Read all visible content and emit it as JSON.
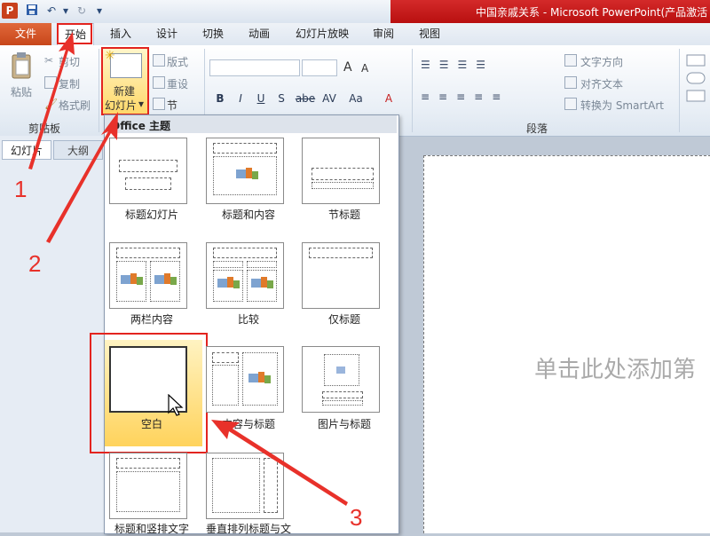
{
  "window": {
    "title": "中国亲戚关系 - Microsoft PowerPoint(产品激活",
    "app_icon": "P"
  },
  "tabs": {
    "file": "文件",
    "home": "开始",
    "insert": "插入",
    "design": "设计",
    "transitions": "切换",
    "animations": "动画",
    "slideshow": "幻灯片放映",
    "review": "审阅",
    "view": "视图"
  },
  "ribbon": {
    "clipboard": {
      "paste": "粘贴",
      "cut": "剪切",
      "copy": "复制",
      "format_painter": "格式刷",
      "label": "剪贴板"
    },
    "slides": {
      "new_slide_line1": "新建",
      "new_slide_line2": "幻灯片",
      "layout": "版式",
      "reset": "重设",
      "section": "节"
    },
    "font": {
      "grow": "A",
      "shrink": "A",
      "bold": "B",
      "italic": "I",
      "underline": "U",
      "shadow": "S",
      "strike": "abe",
      "spacing": "AV",
      "case": "Aa",
      "color": "A"
    },
    "paragraph": {
      "text_direction": "文字方向",
      "align_text": "对齐文本",
      "convert_smartart": "转换为 SmartArt",
      "label": "段落"
    }
  },
  "pane": {
    "tab_slides": "幻灯片",
    "tab_outline": "大纲"
  },
  "slide": {
    "placeholder": "单击此处添加第"
  },
  "gallery": {
    "title": "Office 主题",
    "layouts": [
      "标题幻灯片",
      "标题和内容",
      "节标题",
      "两栏内容",
      "比较",
      "仅标题",
      "空白",
      "内容与标题",
      "图片与标题",
      "标题和竖排文字",
      "垂直排列标题与文"
    ]
  },
  "annotations": {
    "step1": "1",
    "step2": "2",
    "step3": "3"
  },
  "colors": {
    "accent_red": "#e3241f",
    "file_tab": "#c8461a",
    "selected": "#ffd35c"
  },
  "icons": [
    "app-icon",
    "save-icon",
    "undo-icon",
    "redo-icon",
    "paste-icon",
    "cut-icon",
    "copy-icon",
    "format-painter-icon",
    "new-slide-icon",
    "cursor-icon",
    "picture-placeholder-icon"
  ]
}
